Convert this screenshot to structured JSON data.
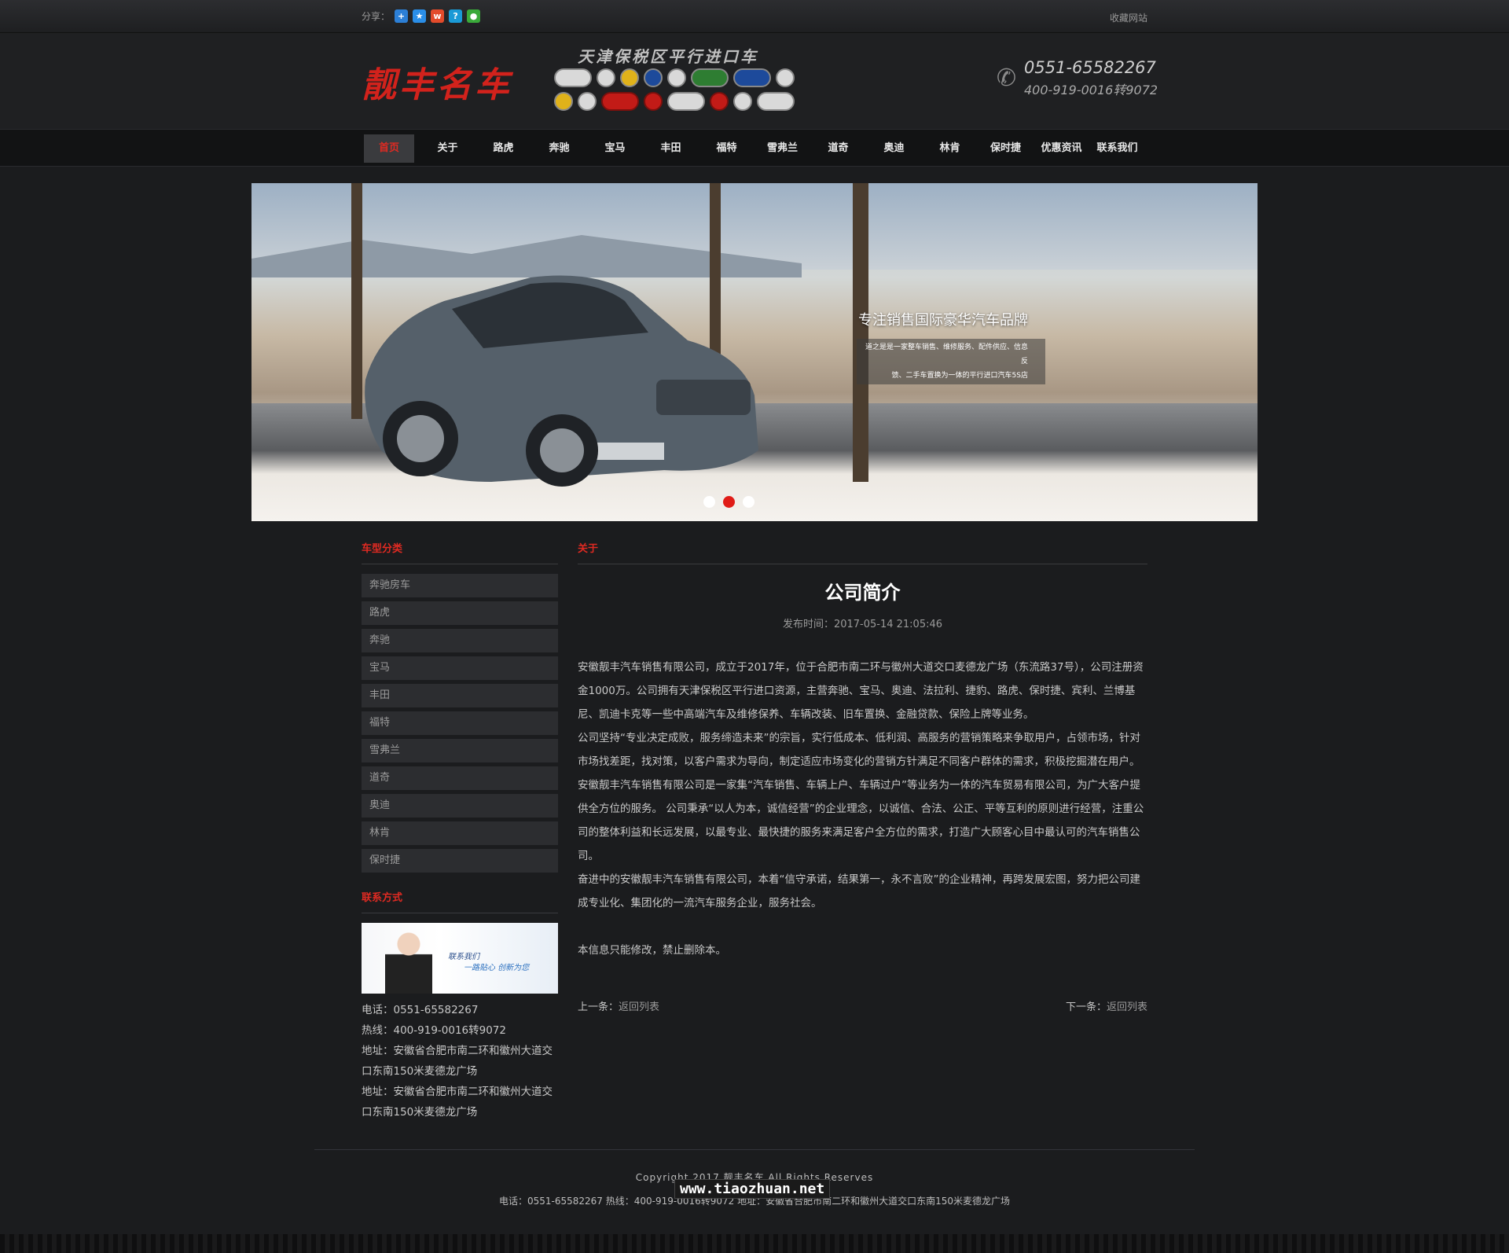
{
  "topbar": {
    "share_label": "分享：",
    "share_icons": [
      "qzone-icon",
      "favorite-icon",
      "weibo-icon",
      "tencent-icon",
      "wechat-icon"
    ],
    "favorite_label": "收藏网站"
  },
  "header": {
    "logo_text": "靓丰名车",
    "slogan": "天津保税区平行进口车",
    "phone1": "0551-65582267",
    "phone2": "400-919-0016转9072"
  },
  "nav": {
    "items": [
      "首页",
      "关于",
      "路虎",
      "奔驰",
      "宝马",
      "丰田",
      "福特",
      "雪弗兰",
      "道奇",
      "奥迪",
      "林肯",
      "保时捷",
      "优惠资讯",
      "联系我们"
    ],
    "active_index": 0
  },
  "banner": {
    "title": "专注销售国际豪华汽车品牌",
    "desc1": "道之是是一家整车销售、维修服务、配件供应、信息反",
    "desc2": "馈、二手车置换为一体的平行进口汽车5S店",
    "slide_count": 3,
    "active_slide": 2
  },
  "sidebar": {
    "category_title": "车型分类",
    "categories": [
      "奔驰房车",
      "路虎",
      "奔驰",
      "宝马",
      "丰田",
      "福特",
      "雪弗兰",
      "道奇",
      "奥迪",
      "林肯",
      "保时捷"
    ],
    "contact_title": "联系方式",
    "contact_img_text1": "联系我们",
    "contact_img_text2": "一路贴心 创新为您",
    "tel": "电话：0551-65582267",
    "hotline": "热线：400-919-0016转9072",
    "address1": "地址：安徽省合肥市南二环和徽州大道交口东南150米麦德龙广场",
    "address2": "地址：安徽省合肥市南二环和徽州大道交口东南150米麦德龙广场"
  },
  "main": {
    "section_title": "关于",
    "article_title": "公司简介",
    "pubdate": "发布时间：2017-05-14 21:05:46",
    "paragraphs": [
      "安徽靓丰汽车销售有限公司，成立于2017年，位于合肥市南二环与徽州大道交口麦德龙广场（东流路37号），公司注册资金1000万。公司拥有天津保税区平行进口资源，主营奔驰、宝马、奥迪、法拉利、捷豹、路虎、保时捷、宾利、兰博基尼、凯迪卡克等一些中高端汽车及维修保养、车辆改装、旧车置换、金融贷款、保险上牌等业务。",
      "公司坚持“专业决定成败，服务缔造未来”的宗旨，实行低成本、低利润、高服务的营销策略来争取用户，占领市场，针对市场找差距，找对策，以客户需求为导向，制定适应市场变化的营销方针满足不同客户群体的需求，积极挖掘潜在用户。",
      "安徽靓丰汽车销售有限公司是一家集“汽车销售、车辆上户、车辆过户”等业务为一体的汽车贸易有限公司，为广大客户提供全方位的服务。 公司秉承“以人为本，诚信经营”的企业理念，以诚信、合法、公正、平等互利的原则进行经营，注重公司的整体利益和长远发展，以最专业、最快捷的服务来满足客户全方位的需求，打造广大顾客心目中最认可的汽车销售公司。",
      "奋进中的安徽靓丰汽车销售有限公司，本着“信守承诺，结果第一，永不言败”的企业精神，再跨发展宏图，努力把公司建成专业化、集团化的一流汽车服务企业，服务社会。"
    ],
    "note": "本信息只能修改，禁止删除本。",
    "prev_label": "上一条：",
    "prev_link": "返回列表",
    "next_label": "下一条：",
    "next_link": "返回列表"
  },
  "footer": {
    "copyright": "Copyright 2017 靓丰名车 All Rights Reserves",
    "contact_line": "电话：0551-65582267 热线：400-919-0016转9072 地址：安徽省合肥市南二环和徽州大道交口东南150米麦德龙广场",
    "watermark": "www.tiaozhuan.net"
  },
  "colors": {
    "accent": "#e02a22",
    "background": "#1b1c1e",
    "nav_bg": "#121314"
  }
}
